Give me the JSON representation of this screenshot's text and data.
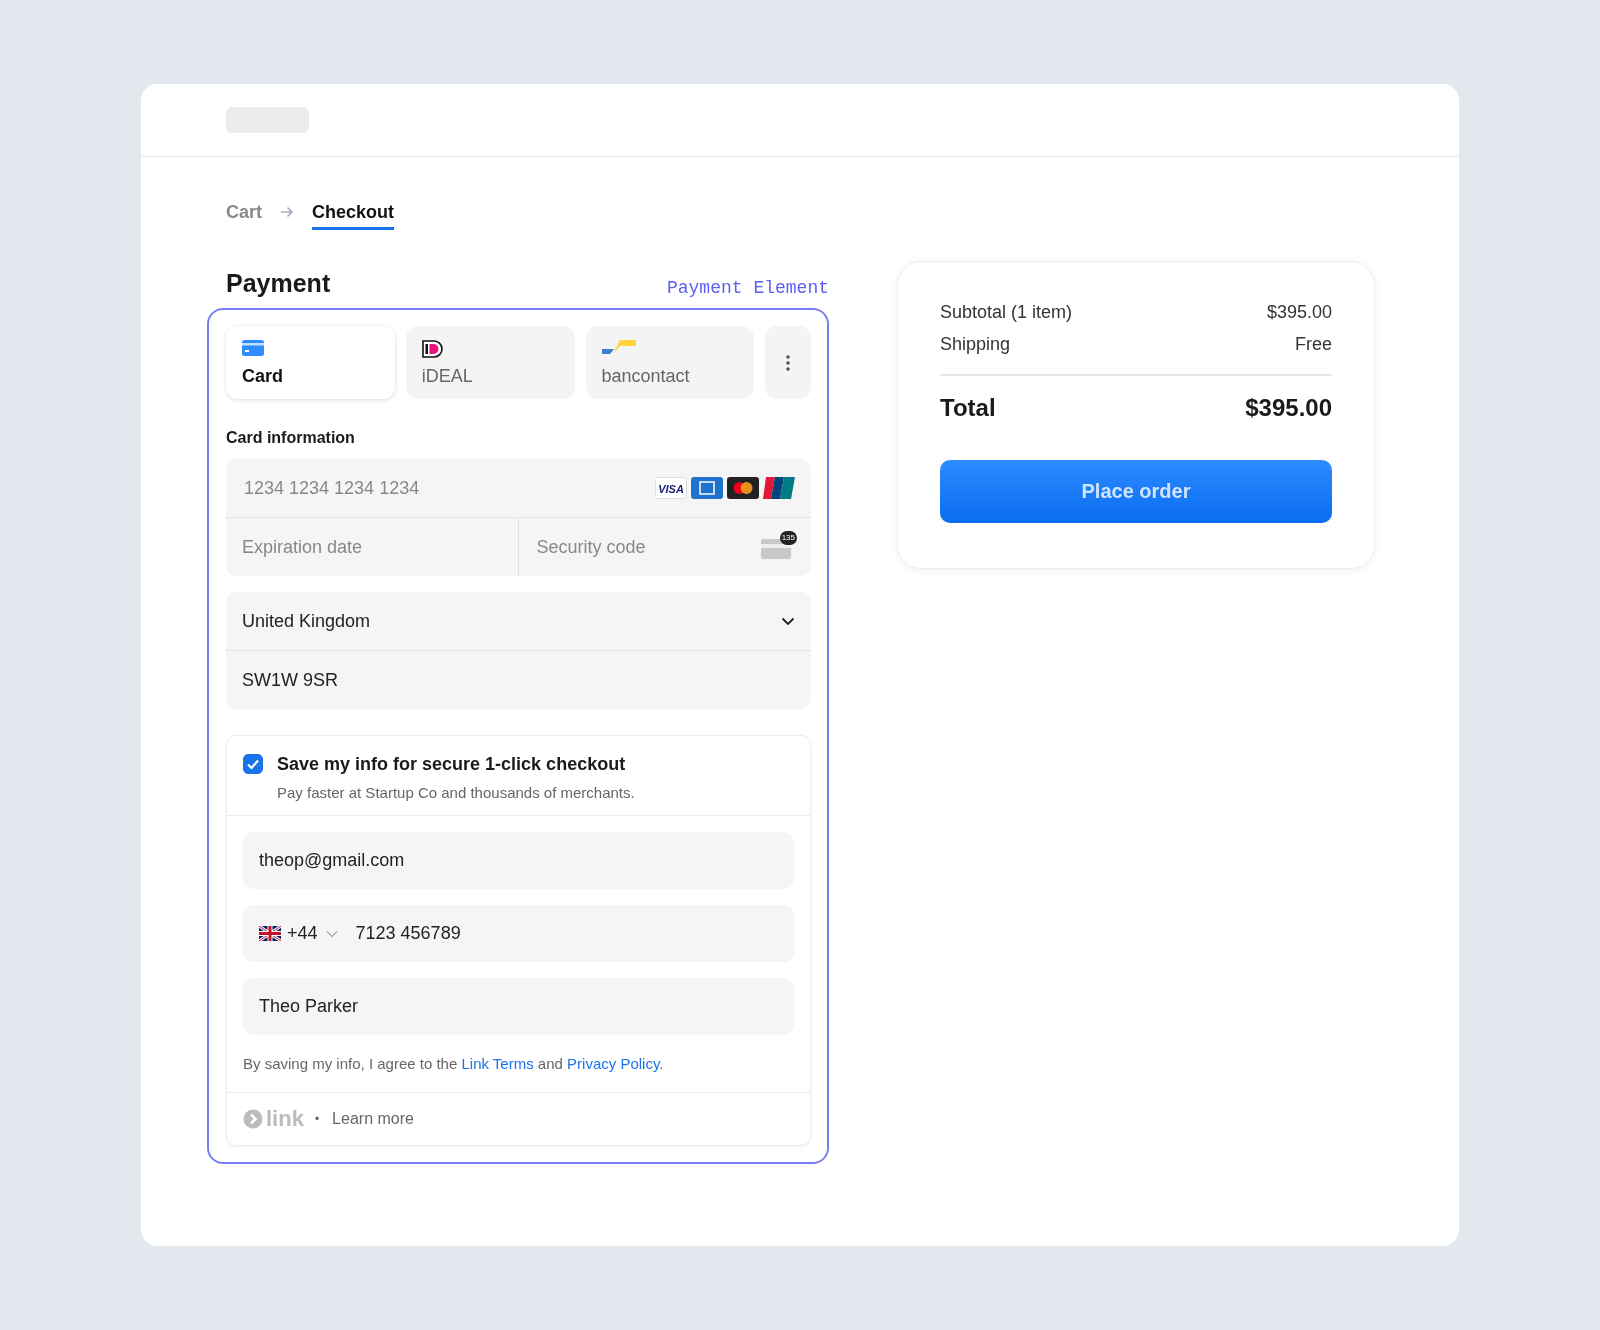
{
  "breadcrumb": [
    {
      "label": "Cart",
      "selected": false
    },
    {
      "label": "Checkout",
      "selected": true
    }
  ],
  "payment": {
    "title": "Payment",
    "annotation": "Payment Element",
    "methods": [
      {
        "kind": "card",
        "label": "Card",
        "selected": true
      },
      {
        "kind": "ideal",
        "label": "iDEAL",
        "selected": false
      },
      {
        "kind": "bancontact",
        "label": "bancontact",
        "selected": false
      }
    ],
    "card_info": {
      "label": "Card information",
      "number_placeholder": "1234 1234 1234 1234",
      "brands": [
        {
          "kind": "visa",
          "text": "VISA"
        },
        {
          "kind": "amex"
        },
        {
          "kind": "mastercard"
        },
        {
          "kind": "unionpay"
        }
      ],
      "expiry_placeholder": "Expiration date",
      "security_placeholder": "Security code",
      "cvc_badge": "135"
    },
    "address": {
      "country": "United Kingdom",
      "postal_code": "SW1W 9SR"
    },
    "link": {
      "checked": true,
      "title": "Save my info for secure 1-click checkout",
      "subtitle": "Pay faster at Startup Co and thousands of merchants.",
      "email": "theop@gmail.com",
      "dial_code": "+44",
      "phone": "7123 456789",
      "name": "Theo Parker",
      "terms": {
        "before": "By saving my info, I agree to the ",
        "link_1": "Link Terms",
        "middle": " and ",
        "link_2": "Privacy Policy",
        "after": "."
      },
      "logo_text": "link",
      "separator": "•",
      "learn_more": "Learn more"
    }
  },
  "summary": {
    "rows": [
      {
        "label": "Subtotal (1 item)",
        "value": "$395.00"
      },
      {
        "label": "Shipping",
        "value": "Free"
      }
    ],
    "total": {
      "label": "Total",
      "value": "$395.00"
    },
    "button": "Place order"
  }
}
